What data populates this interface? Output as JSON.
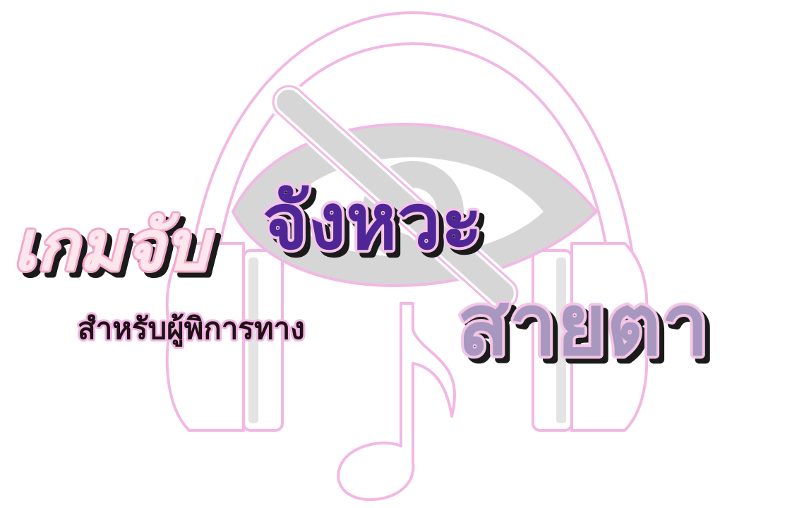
{
  "logo": {
    "title_line1_part1": "เกมจับ",
    "title_line1_part2": "จังหวะ",
    "title_line2_part1": "สำหรับผู้พิการทาง",
    "title_line2_part2": "สายตา",
    "icons": [
      "headphones-icon",
      "eye-slash-icon",
      "music-note-icon"
    ]
  },
  "colors": {
    "background": "#ffffff",
    "outline_pink": "#f2b8e4",
    "icon_grey": "#d6d6d6",
    "icon_white": "#ffffff",
    "title_pink_fill": "#fde6ec",
    "title_purple_fill": "#4f2696",
    "title_lavender_fill": "#a898bf",
    "title_dark_fill": "#221018",
    "text_shadow": "#1a1a1a"
  }
}
